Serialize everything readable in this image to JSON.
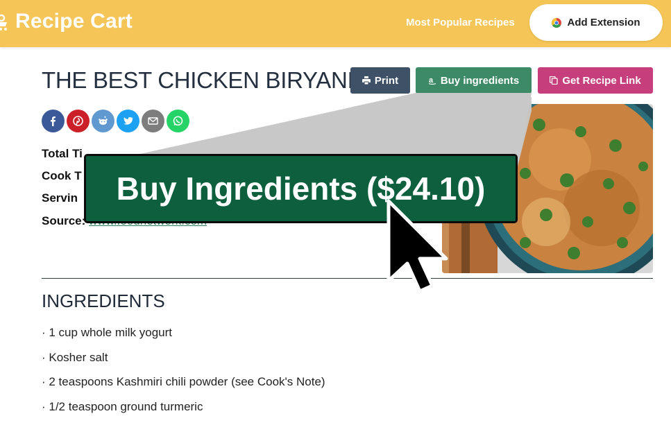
{
  "header": {
    "brand": "Recipe Cart",
    "nav_link": "Most Popular Recipes",
    "extension_button": "Add Extension"
  },
  "recipe": {
    "title": "THE BEST CHICKEN BIRYANI",
    "buttons": {
      "print": "Print",
      "buy": "Buy ingredients",
      "link": "Get Recipe Link"
    },
    "social": [
      "facebook-icon",
      "pinterest-icon",
      "reddit-icon",
      "twitter-icon",
      "email-icon",
      "whatsapp-icon"
    ],
    "meta": {
      "total_time_label": "Total Ti",
      "cook_time_label": "Cook T",
      "servings_label": "Servin",
      "source_label": "Source:",
      "source_value": "www.foodnetwork.com"
    }
  },
  "ingredients": {
    "heading": "INGREDIENTS",
    "items": [
      "· 1 cup whole milk yogurt",
      "· Kosher salt",
      "· 2 teaspoons Kashmiri chili powder (see Cook's Note)",
      "· 1/2 teaspoon ground turmeric"
    ]
  },
  "callout": {
    "label": "Buy Ingredients ($24.10)"
  },
  "colors": {
    "header_bg": "#f5c657",
    "print_btn": "#3e5166",
    "buy_btn": "#3d8a67",
    "link_btn": "#c63e7b",
    "callout_bg": "#0d5f3e"
  }
}
